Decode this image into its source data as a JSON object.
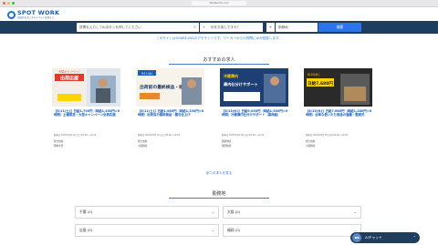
{
  "browser": {
    "url": "fieldwork.com"
  },
  "brand": {
    "title": "SPOT WORK",
    "subtitle": "自由気ままにスキマバイトを探そう"
  },
  "search": {
    "keyword_placeholder": "質問を入力してAIボタンを押してください",
    "clear_icon": "close-icon",
    "location_placeholder": "何をお探しですか？",
    "area_placeholder": "勤務地",
    "button_label": "検索"
  },
  "notice": {
    "text": "このサイトはSHARE-INGのデモサイトです。ワーカーからの質問にAIが回答します。",
    "link_text": "AIが回答"
  },
  "recommended": {
    "heading": "おすすめの求人",
    "cards": [
      {
        "title": "【8/11(土)】日給1,700円（時給1,450円×6時間）土曜限定・大型キャンペーン出荷応援",
        "banner_text": "出荷応援",
        "banner_sub": "大型キャンペーン",
        "date": "勤務日:2025年8月11日(土)06:00〜12:00",
        "company": "軽大技術",
        "location": "岡崎市西"
      },
      {
        "title": "【8/11(土)】日給1,980円（時給1,330円×6時間）出荷前の最終検品・梱包仕上げ",
        "banner_text": "出荷前の最終検品・梱包",
        "banner_sub": "8/11(土)",
        "date": "勤務日:2025年8月11日(土)06:00〜12:00",
        "company": "軽大技術",
        "location": "大阪物流"
      },
      {
        "title": "【8/15(水)】日給9,000円（時給1,500円×6時間）冷蔵庫内仕分けサポート（高時給）",
        "banner_text": "庫内仕分けサポート",
        "banner_sub": "冷蔵庫内",
        "date": "勤務日:2025年8月15日(水)06:00〜12:00",
        "company": "関東物流",
        "location": "関西物流"
      },
      {
        "title": "【8/15(木)】日給7,680円（時給1,280円×6時間）合単な使いたち用品の運搬・整威式",
        "banner_text": "日給7,680円",
        "banner_sub": "8/15(木)",
        "date": "勤務日:2025年8月15日(木)06:00〜12:00",
        "company": "軽大技術",
        "location": "大阪物流"
      }
    ],
    "more_link": "全ての求人を見る"
  },
  "regions": {
    "heading": "勤務地",
    "items": [
      "千葉 (0)",
      "大阪 (0)",
      "広島 (0)",
      "福岡 (0)"
    ]
  },
  "chat": {
    "label": "AIチャット"
  },
  "colors": {
    "primary": "#1f3e5d",
    "accent": "#2e74e8",
    "link": "#2b7bd5"
  }
}
